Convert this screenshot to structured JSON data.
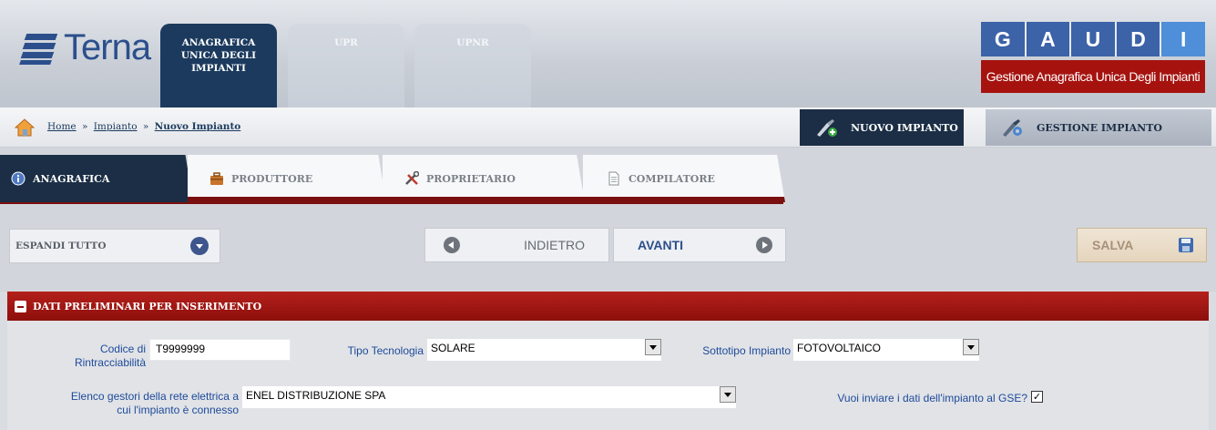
{
  "brand": {
    "logo_text": "Terna"
  },
  "top_tabs": [
    {
      "label": "ANAGRAFICA UNICA DEGLI IMPIANTI",
      "active": true
    },
    {
      "label": "UPR",
      "active": false
    },
    {
      "label": "UPNR",
      "active": false
    }
  ],
  "gaudi": {
    "letters": [
      "G",
      "A",
      "U",
      "D",
      "I"
    ],
    "subtitle": "Gestione Anagrafica Unica Degli Impianti"
  },
  "breadcrumb": {
    "home": "Home",
    "sep": "»",
    "impianto": "Impianto",
    "current": "Nuovo Impianto"
  },
  "actions": {
    "nuovo": "NUOVO IMPIANTO",
    "gestione": "GESTIONE IMPIANTO"
  },
  "section_tabs": [
    {
      "label": "ANAGRAFICA",
      "active": true,
      "icon": "info-icon"
    },
    {
      "label": "PRODUTTORE",
      "active": false,
      "icon": "briefcase-icon"
    },
    {
      "label": "PROPRIETARIO",
      "active": false,
      "icon": "tools-icon"
    },
    {
      "label": "COMPILATORE",
      "active": false,
      "icon": "document-icon"
    }
  ],
  "toolbar": {
    "espandi": "ESPANDI TUTTO",
    "indietro": "INDIETRO",
    "avanti": "AVANTI",
    "salva": "SALVA"
  },
  "section": {
    "title": "DATI PRELIMINARI PER INSERIMENTO",
    "fields": {
      "codice_label_1": "Codice di",
      "codice_label_2": "Rintracciabilità",
      "codice_value": "T9999999",
      "tipo_label": "Tipo Tecnologia",
      "tipo_value": "SOLARE",
      "sottotipo_label": "Sottotipo Impianto",
      "sottotipo_value": "FOTOVOLTAICO",
      "gestori_label_1": "Elenco gestori della rete elettrica a",
      "gestori_label_2": "cui l'impianto è connesso",
      "gestori_value": "ENEL DISTRIBUZIONE SPA",
      "gse_label": "Vuoi inviare i dati dell'impianto al GSE?",
      "gse_checked": true,
      "gse_mark": "✓"
    }
  },
  "colors": {
    "navy": "#1b2e45",
    "red": "#8d0f0c",
    "brand_blue": "#2c4f8c",
    "label_blue": "#1e4a9a"
  }
}
